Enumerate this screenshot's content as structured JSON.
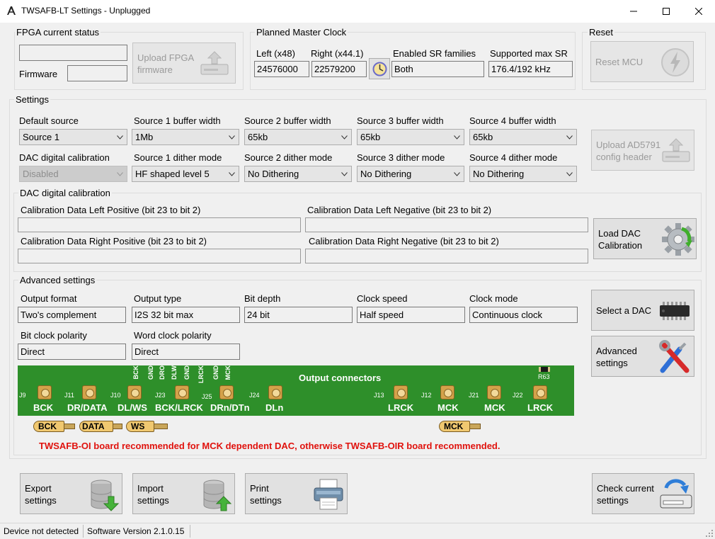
{
  "window": {
    "title": "TWSAFB-LT Settings - Unplugged"
  },
  "fpga": {
    "group_label": "FPGA current status",
    "status_value": "",
    "firmware_label": "Firmware",
    "firmware_value": "",
    "upload_button": "Upload FPGA\nfirmware"
  },
  "clock": {
    "group_label": "Planned Master Clock",
    "left_label": "Left (x48)",
    "left_value": "24576000",
    "right_label": "Right (x44.1)",
    "right_value": "22579200",
    "sr_families_label": "Enabled SR families",
    "sr_families_value": "Both",
    "max_sr_label": "Supported max SR",
    "max_sr_value": "176.4/192 kHz"
  },
  "reset": {
    "group_label": "Reset",
    "button": "Reset MCU"
  },
  "settings": {
    "group_label": "Settings",
    "default_source": {
      "label": "Default source",
      "value": "Source 1"
    },
    "s1_buffer": {
      "label": "Source 1 buffer width",
      "value": "1Mb"
    },
    "s2_buffer": {
      "label": "Source 2 buffer width",
      "value": "65kb"
    },
    "s3_buffer": {
      "label": "Source 3 buffer width",
      "value": "65kb"
    },
    "s4_buffer": {
      "label": "Source 4 buffer width",
      "value": "65kb"
    },
    "dac_cal": {
      "label": "DAC digital calibration",
      "value": "Disabled"
    },
    "s1_dither": {
      "label": "Source 1 dither mode",
      "value": "HF shaped level 5"
    },
    "s2_dither": {
      "label": "Source 2 dither mode",
      "value": "No Dithering"
    },
    "s3_dither": {
      "label": "Source 3 dither mode",
      "value": "No Dithering"
    },
    "s4_dither": {
      "label": "Source 4 dither mode",
      "value": "No Dithering"
    },
    "upload_ad5791_button": "Upload AD5791\nconfig header"
  },
  "calibration": {
    "group_label": "DAC digital calibration",
    "left_pos_label": "Calibration Data Left Positive (bit 23 to bit 2)",
    "left_pos_value": "",
    "left_neg_label": "Calibration Data Left Negative (bit 23 to bit 2)",
    "left_neg_value": "",
    "right_pos_label": "Calibration Data Right Positive (bit 23 to bit 2)",
    "right_pos_value": "",
    "right_neg_label": "Calibration Data Right Negative (bit 23 to bit 2)",
    "right_neg_value": "",
    "load_button": "Load DAC\nCalibration"
  },
  "advanced": {
    "group_label": "Advanced settings",
    "output_format": {
      "label": "Output format",
      "value": "Two's complement"
    },
    "output_type": {
      "label": "Output type",
      "value": "I2S 32 bit max"
    },
    "bit_depth": {
      "label": "Bit depth",
      "value": "24 bit"
    },
    "clock_speed": {
      "label": "Clock speed",
      "value": "Half speed"
    },
    "clock_mode": {
      "label": "Clock mode",
      "value": "Continuous clock"
    },
    "bit_clock_polarity": {
      "label": "Bit clock polarity",
      "value": "Direct"
    },
    "word_clock_polarity": {
      "label": "Word clock polarity",
      "value": "Direct"
    },
    "select_dac_button": "Select a DAC",
    "advanced_button": "Advanced\nsettings"
  },
  "connectors": {
    "title": "Output connectors",
    "ref_r63": "R63",
    "top_pins": [
      "BCK",
      "GND",
      "DRO",
      "DLW",
      "GND",
      "LRCK",
      "GND",
      "MCK"
    ],
    "jacks": [
      {
        "ref": "J9",
        "label": "BCK"
      },
      {
        "ref": "J11",
        "label": "DR/DATA"
      },
      {
        "ref": "J10",
        "label": "DL/WS"
      },
      {
        "ref": "J23",
        "label": "BCK/LRCK"
      },
      {
        "ref": "J25",
        "label": "DRn/DTn"
      },
      {
        "ref": "J24",
        "label": "DLn"
      },
      {
        "ref": "J13",
        "label": "LRCK"
      },
      {
        "ref": "J12",
        "label": "MCK"
      },
      {
        "ref": "J21",
        "label": "MCK"
      },
      {
        "ref": "J22",
        "label": "LRCK"
      }
    ],
    "plugs": [
      "BCK",
      "DATA",
      "WS",
      "MCK"
    ],
    "recommendation": "TWSAFB-OI board recommended for MCK dependent DAC, otherwise TWSAFB-OIR board recommended.",
    "colors": {
      "pcb": "#2e8f2a",
      "warning": "#e0120d"
    }
  },
  "actions": {
    "export": "Export\nsettings",
    "import": "Import\nsettings",
    "print": "Print\nsettings",
    "check": "Check current\nsettings"
  },
  "status": {
    "device": "Device not detected",
    "version": "Software Version 2.1.0.15"
  }
}
